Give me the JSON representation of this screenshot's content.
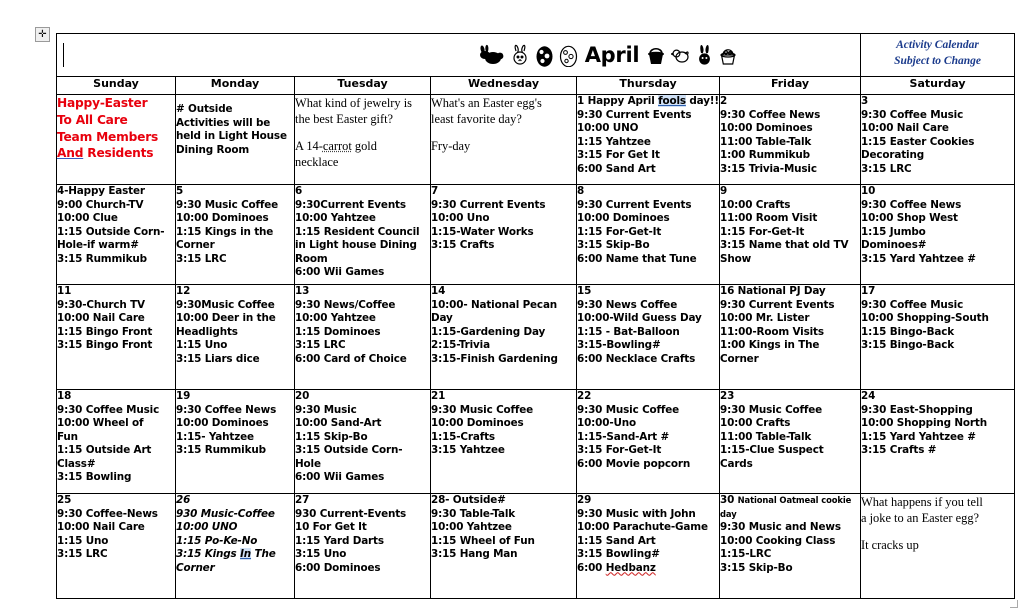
{
  "document": {
    "month_label": "April",
    "subject_line1": "Activity Calendar",
    "subject_line2": "Subject to Change",
    "move_handle_glyph": "✛"
  },
  "weekdays": [
    "Sunday",
    "Monday",
    "Tuesday",
    "Wednesday",
    "Thursday",
    "Friday",
    "Saturday"
  ],
  "decorations": [
    "bunny-solid-icon",
    "bunny-outline-icon",
    "easter-egg-solid-icon",
    "easter-egg-outline-icon",
    "month-word",
    "easter-basket-solid-icon",
    "chick-outline-icon",
    "bunny-face-solid-icon",
    "easter-basket-outline-icon"
  ],
  "colors": {
    "greeting_red": "#e8000d",
    "subject_blue": "#1b3b8c",
    "spellcheck_highlight": "#cfe0f5",
    "grid": "#000000"
  },
  "weeks": [
    {
      "cells": [
        {
          "kind": "greeting",
          "lines": [
            "Happy-Easter",
            "To All Care",
            "Team Members",
            "And Residents"
          ],
          "underline_last": true
        },
        {
          "kind": "note",
          "lines": [
            "# Outside",
            "Activities will be",
            "held in Light House",
            "Dining Room"
          ]
        },
        {
          "kind": "joke",
          "lines": [
            "What kind of jewelry is",
            "the best Easter gift?",
            "",
            "A 14-carrot gold",
            "necklace"
          ]
        },
        {
          "kind": "joke",
          "lines": [
            "What's an Easter egg's",
            "least favorite day?",
            "",
            "Fry-day"
          ]
        },
        {
          "kind": "day",
          "date": "1",
          "title": "Happy April fools day!!",
          "events": [
            "9:30 Current Events",
            "10:00 UNO",
            "1:15 Yahtzee",
            "3:15 For Get It",
            "6:00 Sand Art"
          ]
        },
        {
          "kind": "day",
          "date": "2",
          "title": "",
          "events": [
            "9:30 Coffee News",
            "10:00 Dominoes",
            "11:00 Table-Talk",
            "1:00 Rummikub",
            "3:15 Trivia-Music"
          ]
        },
        {
          "kind": "day",
          "date": "3",
          "title": "",
          "events": [
            "9:30 Coffee Music",
            "10:00 Nail Care",
            "1:15 Easter Cookies",
            "Decorating",
            "3:15 LRC"
          ]
        }
      ]
    },
    {
      "cells": [
        {
          "kind": "day",
          "date": "4-Happy Easter",
          "title": "",
          "events": [
            "9:00 Church-TV",
            "10:00 Clue",
            "1:15 Outside Corn-",
            "Hole-if warm#",
            "3:15 Rummikub"
          ]
        },
        {
          "kind": "day",
          "date": "5",
          "title": "",
          "events": [
            "9:30 Music Coffee",
            "10:00 Dominoes",
            "1:15 Kings in the",
            "Corner",
            "3:15 LRC"
          ]
        },
        {
          "kind": "day",
          "date": "6",
          "title": "",
          "events": [
            "9:30Current Events",
            "10:00 Yahtzee",
            "1:15 Resident Council",
            "in Light house Dining",
            "Room",
            "6:00 Wii Games"
          ]
        },
        {
          "kind": "day",
          "date": "7",
          "title": "",
          "events": [
            "9:30 Current Events",
            "10:00 Uno",
            "1:15-Water Works",
            "3:15 Crafts"
          ]
        },
        {
          "kind": "day",
          "date": "8",
          "title": "",
          "events": [
            "9:30 Current Events",
            "10:00 Dominoes",
            "1:15 For-Get-It",
            "3:15 Skip-Bo",
            "6:00 Name that Tune"
          ]
        },
        {
          "kind": "day",
          "date": "9",
          "title": "",
          "events": [
            "10:00 Crafts",
            "11:00 Room Visit",
            "1:15 For-Get-It",
            "3:15 Name that old TV",
            "Show"
          ]
        },
        {
          "kind": "day",
          "date": "10",
          "title": "",
          "events": [
            " 9:30 Coffee News",
            "10:00 Shop West",
            "1:15 Jumbo",
            "Dominoes#",
            "3:15 Yard Yahtzee #"
          ]
        }
      ]
    },
    {
      "cells": [
        {
          "kind": "day",
          "date": "11",
          "title": "",
          "events": [
            "9:30-Church TV",
            "10:00 Nail Care",
            "1:15 Bingo Front",
            "3:15 Bingo Front"
          ]
        },
        {
          "kind": "day",
          "date": "12",
          "title": "",
          "events": [
            "9:30Music Coffee",
            "10:00 Deer in the",
            "Headlights",
            "1:15 Uno",
            "3:15 Liars dice"
          ]
        },
        {
          "kind": "day",
          "date": "13",
          "title": "",
          "events": [
            "9:30 News/Coffee",
            "10:00 Yahtzee",
            "1:15 Dominoes",
            "3:15 LRC",
            "6:00 Card of Choice"
          ]
        },
        {
          "kind": "day",
          "date": "14",
          "title": "",
          "events": [
            "10:00- National Pecan",
            "Day",
            "1:15-Gardening Day",
            "2:15-Trivia",
            "3:15-Finish Gardening"
          ]
        },
        {
          "kind": "day",
          "date": "15",
          "title": "",
          "events": [
            "9:30 News Coffee",
            "10:00-Wild Guess Day",
            "1:15 - Bat-Balloon",
            "3:15-Bowling#",
            "6:00 Necklace Crafts"
          ]
        },
        {
          "kind": "day",
          "date": "16",
          "title": "National PJ Day",
          "events": [
            "9:30 Current Events",
            "10:00 Mr. Lister",
            "11:00-Room Visits",
            "1:00 Kings in The",
            "Corner"
          ]
        },
        {
          "kind": "day",
          "date": "17",
          "title": "",
          "events": [
            "9:30 Coffee Music",
            "10:00 Shopping-South",
            "1:15 Bingo-Back",
            "3:15 Bingo-Back"
          ]
        }
      ]
    },
    {
      "cells": [
        {
          "kind": "day",
          "date": "18",
          "title": "",
          "events": [
            "9:30 Coffee  Music",
            "10:00 Wheel of",
            "Fun",
            "1:15 Outside Art",
            "Class#",
            "3:15 Bowling"
          ]
        },
        {
          "kind": "day",
          "date": "19",
          "title": "",
          "events": [
            "9:30 Coffee News",
            "10:00 Dominoes",
            "1:15- Yahtzee",
            "3:15 Rummikub"
          ]
        },
        {
          "kind": "day",
          "date": "20",
          "title": "",
          "events": [
            "9:30 Music",
            "10:00 Sand-Art",
            "1:15 Skip-Bo",
            "3:15 Outside Corn-",
            "Hole",
            "6:00 Wii Games"
          ]
        },
        {
          "kind": "day",
          "date": "21",
          "title": "",
          "events": [
            "9:30 Music Coffee",
            "10:00 Dominoes",
            "1:15-Crafts",
            "3:15 Yahtzee"
          ]
        },
        {
          "kind": "day",
          "date": "22",
          "title": "",
          "events": [
            "9:30 Music Coffee",
            "10:00-Uno",
            "1:15-Sand-Art #",
            "3:15 For-Get-It",
            "6:00 Movie popcorn"
          ]
        },
        {
          "kind": "day",
          "date": "23",
          "title": "",
          "events": [
            "9:30 Music Coffee",
            "10:00 Crafts",
            "11:00 Table-Talk",
            "1:15-Clue Suspect",
            "Cards"
          ]
        },
        {
          "kind": "day",
          "date": "24",
          "title": "",
          "events": [
            "9:30 East-Shopping",
            "10:00 Shopping North",
            "1:15 Yard Yahtzee #",
            "3:15 Crafts #"
          ]
        }
      ]
    },
    {
      "cells": [
        {
          "kind": "day",
          "date": "25",
          "title": "",
          "events": [
            "9:30 Coffee-News",
            "10:00 Nail Care",
            "1:15 Uno",
            "3:15 LRC"
          ]
        },
        {
          "kind": "day-italic",
          "date": "26",
          "title": "",
          "events": [
            "930 Music-Coffee",
            "10:00 UNO",
            "1:15 Po-Ke-No",
            "3:15 Kings In The",
            "Corner"
          ]
        },
        {
          "kind": "day",
          "date": "27",
          "title": "",
          "events": [
            "930 Current-Events",
            "10 For Get It",
            "1:15 Yard Darts",
            "3:15 Uno",
            "6:00 Dominoes"
          ]
        },
        {
          "kind": "day",
          "date": "28- Outside#",
          "title": "",
          "events": [
            "9:30 Table-Talk",
            "10:00 Yahtzee",
            "1:15 Wheel of Fun",
            "3:15 Hang Man"
          ]
        },
        {
          "kind": "day",
          "date": "29",
          "title": "",
          "events": [
            "9:30 Music with John",
            "10:00 Parachute-Game",
            "1:15 Sand Art",
            "3:15 Bowling#",
            "6:00 Hedbanz"
          ]
        },
        {
          "kind": "day",
          "date": "30",
          "title": "National Oatmeal cookie day",
          "events": [
            "9:30 Music and News",
            "10:00 Cooking Class",
            "1:15-LRC",
            "3:15 Skip-Bo"
          ]
        },
        {
          "kind": "joke",
          "lines": [
            "What happens if you tell",
            "a joke to an Easter egg?",
            "",
            "It cracks up"
          ]
        }
      ]
    }
  ]
}
